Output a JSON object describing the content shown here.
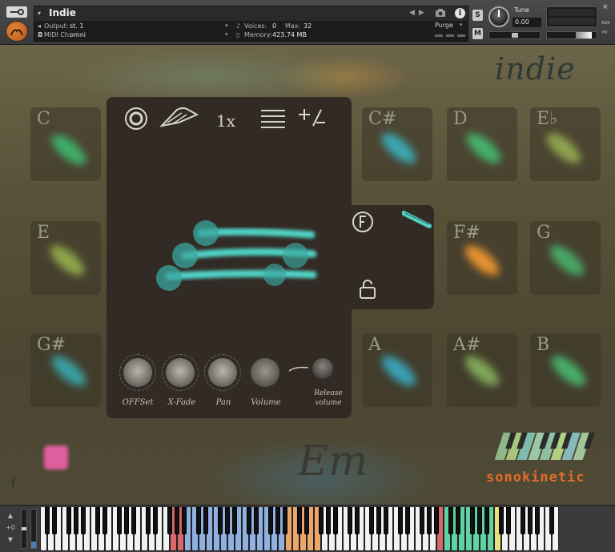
{
  "header": {
    "instrument_name": "Indie",
    "output_label": "Output:",
    "output_value": "st. 1",
    "midi_label": "MIDI Ch:",
    "midi_value": "omni",
    "voices_label": "Voices:",
    "voices_value": "0",
    "max_label": "Max:",
    "max_value": "32",
    "memory_label": "Memory:",
    "memory_value": "423.74 MB",
    "purge_label": "Purge",
    "solo_label": "S",
    "mute_label": "M",
    "tune_label": "Tune",
    "tune_value": "0.00",
    "aux_label": "AUX",
    "pv_label": "PV",
    "close_label": "×",
    "info_label": "i"
  },
  "main": {
    "title": "indie",
    "chord_display": "Em",
    "brand_text": "sonokinetic",
    "info_label": "i",
    "pads": [
      {
        "label": "C",
        "color": "#3fae6a"
      },
      {
        "label": "C#",
        "color": "#3aa7b0"
      },
      {
        "label": "D",
        "color": "#44b06a"
      },
      {
        "label": "E♭",
        "color": "#8fa24e"
      },
      {
        "label": "E",
        "color": "#8ea54a"
      },
      {
        "label": "F#",
        "color": "#e59130"
      },
      {
        "label": "G",
        "color": "#46a765"
      },
      {
        "label": "G#",
        "color": "#3a9ea0"
      },
      {
        "label": "A",
        "color": "#3aa0b5"
      },
      {
        "label": "A#",
        "color": "#7fa656"
      },
      {
        "label": "B",
        "color": "#48ad68"
      }
    ]
  },
  "panel": {
    "multiplier": "1x",
    "knobs": [
      {
        "label": "OFFSet"
      },
      {
        "label": "X-Fade"
      },
      {
        "label": "Pan"
      },
      {
        "label": "Volume"
      }
    ],
    "release_label": "Release volume",
    "icons": [
      "record-icon",
      "pick-icon",
      "lines-icon",
      "plus-minus-icon",
      "f-icon",
      "lock-icon",
      "strings-icon"
    ]
  },
  "keyboard": {
    "octave_label": "+0",
    "key_color_ranges": [
      {
        "name": "red",
        "color": "#d9676a"
      },
      {
        "name": "blue",
        "color": "#8fb0e0"
      },
      {
        "name": "orange",
        "color": "#eba76a"
      },
      {
        "name": "green",
        "color": "#5fd3a5"
      },
      {
        "name": "yellow",
        "color": "#e8e07a"
      }
    ]
  },
  "colors": {
    "panel": "#322a25",
    "accent_teal": "#4fd2c4",
    "brand_orange": "#e56b2a"
  }
}
